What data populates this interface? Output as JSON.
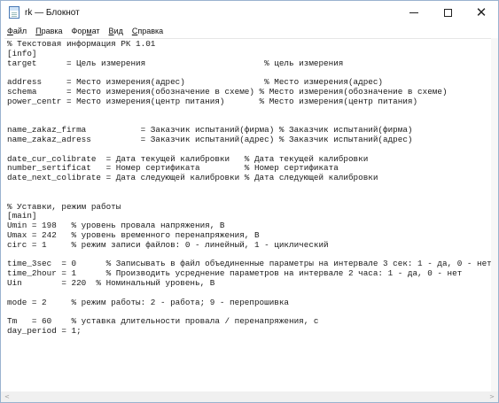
{
  "window": {
    "title": "rk — Блокнот",
    "controls": {
      "minimize_icon": "minimize-icon",
      "maximize_icon": "maximize-icon",
      "close_glyph": "✕"
    }
  },
  "menu": [
    {
      "accel": "Ф",
      "rest": "айл"
    },
    {
      "accel": "П",
      "rest": "равка"
    },
    {
      "pre": "Фор",
      "accel": "м",
      "rest": "ат"
    },
    {
      "accel": "В",
      "rest": "ид"
    },
    {
      "accel": "С",
      "rest": "правка"
    }
  ],
  "editor": {
    "text": "% Текстовая информация РК 1.01\n[info]\ntarget      = Цель измерения                        % цель измерения\n\naddress     = Место измерения(адрес)                % Место измерения(адрес)\nschema      = Место измерения(обозначение в схеме) % Место измерения(обозначение в схеме)\npower_centr = Место измерения(центр питания)       % Место измерения(центр питания)\n\n\nname_zakaz_firma           = Заказчик испытаний(фирма) % Заказчик испытаний(фирма)\nname_zakaz_adress          = Заказчик испытаний(адрес) % Заказчик испытаний(адрес)\n\ndate_cur_colibrate  = Дата текущей калибровки   % Дата текущей калибровки\nnumber_sertificat   = Номер сертификата         % Номер сертификата\ndate_next_colibrate = Дата следующей калибровки % Дата следующей калибровки\n\n\n% Уставки, режим работы\n[main]\nUmin = 198   % уровень провала напряжения, В\nUmax = 242   % уровень временного перенапряжения, В\ncirc = 1     % режим записи файлов: 0 - линейный, 1 - циклический\n\ntime_3sec  = 0      % Записывать в файл объединенные параметры на интервале 3 сек: 1 - да, 0 - нет\ntime_2hour = 1      % Производить усреднение параметров на интервале 2 часа: 1 - да, 0 - нет\nUin        = 220  % Номинальный уровень, В\n\nmode = 2     % режим работы: 2 - работа; 9 - перепрошивка\n\nTm   = 60    % уставка длительности провала / перенапряжения, с\nday_period = 1;"
  },
  "scrollbar": {
    "left_arrow": "<",
    "right_arrow": ">"
  }
}
